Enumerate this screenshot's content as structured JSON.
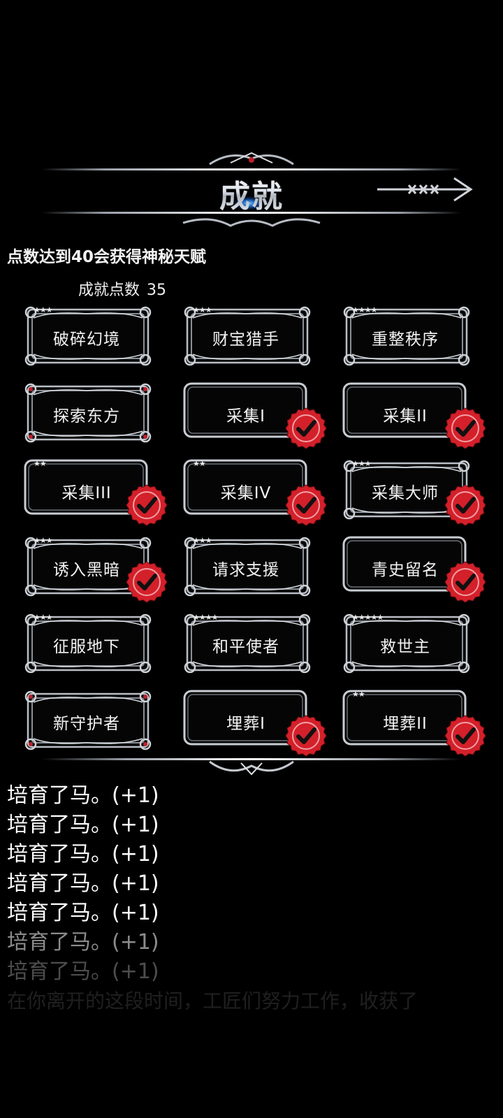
{
  "header": {
    "title": "成就",
    "close_icon": "arrow-close-icon"
  },
  "info_text": "点数达到40会获得神秘天赋",
  "points": {
    "label": "成就点数",
    "value": "35"
  },
  "achievements": [
    {
      "name": "破碎幻境",
      "stars": "★★★",
      "style": "ornate",
      "completed": false
    },
    {
      "name": "财宝猎手",
      "stars": "★★★",
      "style": "ornate",
      "completed": false
    },
    {
      "name": "重整秩序",
      "stars": "★★★★",
      "style": "ornate",
      "completed": false
    },
    {
      "name": "探索东方",
      "stars": "",
      "style": "gem",
      "completed": false
    },
    {
      "name": "采集I",
      "stars": "",
      "style": "plain",
      "completed": true
    },
    {
      "name": "采集II",
      "stars": "",
      "style": "plain",
      "completed": true
    },
    {
      "name": "采集III",
      "stars": "★★",
      "style": "plain",
      "completed": true
    },
    {
      "name": "采集IV",
      "stars": "★★",
      "style": "plain",
      "completed": true
    },
    {
      "name": "采集大师",
      "stars": "★★★",
      "style": "ornate",
      "completed": true
    },
    {
      "name": "诱入黑暗",
      "stars": "★★★",
      "style": "ornate",
      "completed": true
    },
    {
      "name": "请求支援",
      "stars": "★★★",
      "style": "ornate",
      "completed": false
    },
    {
      "name": "青史留名",
      "stars": "",
      "style": "plain",
      "completed": true
    },
    {
      "name": "征服地下",
      "stars": "★★★",
      "style": "ornate",
      "completed": false
    },
    {
      "name": "和平使者",
      "stars": "★★★★",
      "style": "ornate",
      "completed": false
    },
    {
      "name": "救世主",
      "stars": "★★★★★",
      "style": "ornate",
      "completed": false
    },
    {
      "name": "新守护者",
      "stars": "",
      "style": "gem",
      "completed": false
    },
    {
      "name": "埋葬I",
      "stars": "",
      "style": "plain",
      "completed": true
    },
    {
      "name": "埋葬II",
      "stars": "★★",
      "style": "plain",
      "completed": true
    }
  ],
  "log": [
    {
      "text": "培育了马。(+1)",
      "opacity": 1
    },
    {
      "text": "培育了马。(+1)",
      "opacity": 1
    },
    {
      "text": "培育了马。(+1)",
      "opacity": 1
    },
    {
      "text": "培育了马。(+1)",
      "opacity": 1
    },
    {
      "text": "培育了马。(+1)",
      "opacity": 1
    },
    {
      "text": "培育了马。(+1)",
      "opacity": 0.55
    },
    {
      "text": "培育了马。(+1)",
      "opacity": 0.3
    },
    {
      "text": "在你离开的这段时间，工匠们努力工作，收获了",
      "opacity": 0.12
    }
  ],
  "colors": {
    "check_red": "#d3202a",
    "frame_silver": "#c8ccd2",
    "background": "#000000"
  }
}
